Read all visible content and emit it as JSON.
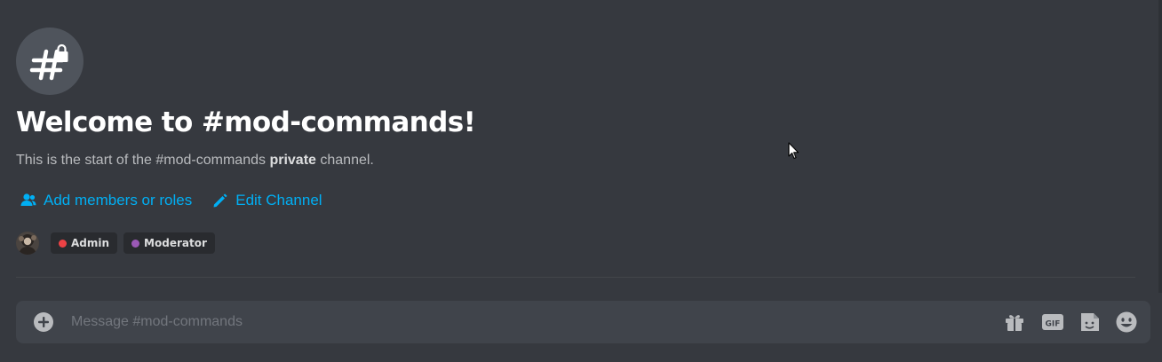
{
  "channel": {
    "name": "#mod-commands",
    "icon": "hashtag-lock-icon"
  },
  "welcome": {
    "title": "Welcome to #mod-commands!",
    "desc_prefix": "This is the start of the #mod-commands ",
    "desc_bold": "private",
    "desc_suffix": " channel."
  },
  "actions": {
    "add_members": {
      "label": "Add members or roles",
      "icon": "people-icon"
    },
    "edit_channel": {
      "label": "Edit Channel",
      "icon": "pencil-icon"
    }
  },
  "roles": [
    {
      "name": "Admin",
      "color": "#ed4245"
    },
    {
      "name": "Moderator",
      "color": "#9b59b6"
    }
  ],
  "composer": {
    "placeholder": "Message #mod-commands",
    "value": "",
    "tools": [
      "gift-icon",
      "gif-icon",
      "sticker-icon",
      "emoji-icon"
    ]
  },
  "colors": {
    "background": "#36393f",
    "link": "#00aff4",
    "composer": "#40444b"
  }
}
